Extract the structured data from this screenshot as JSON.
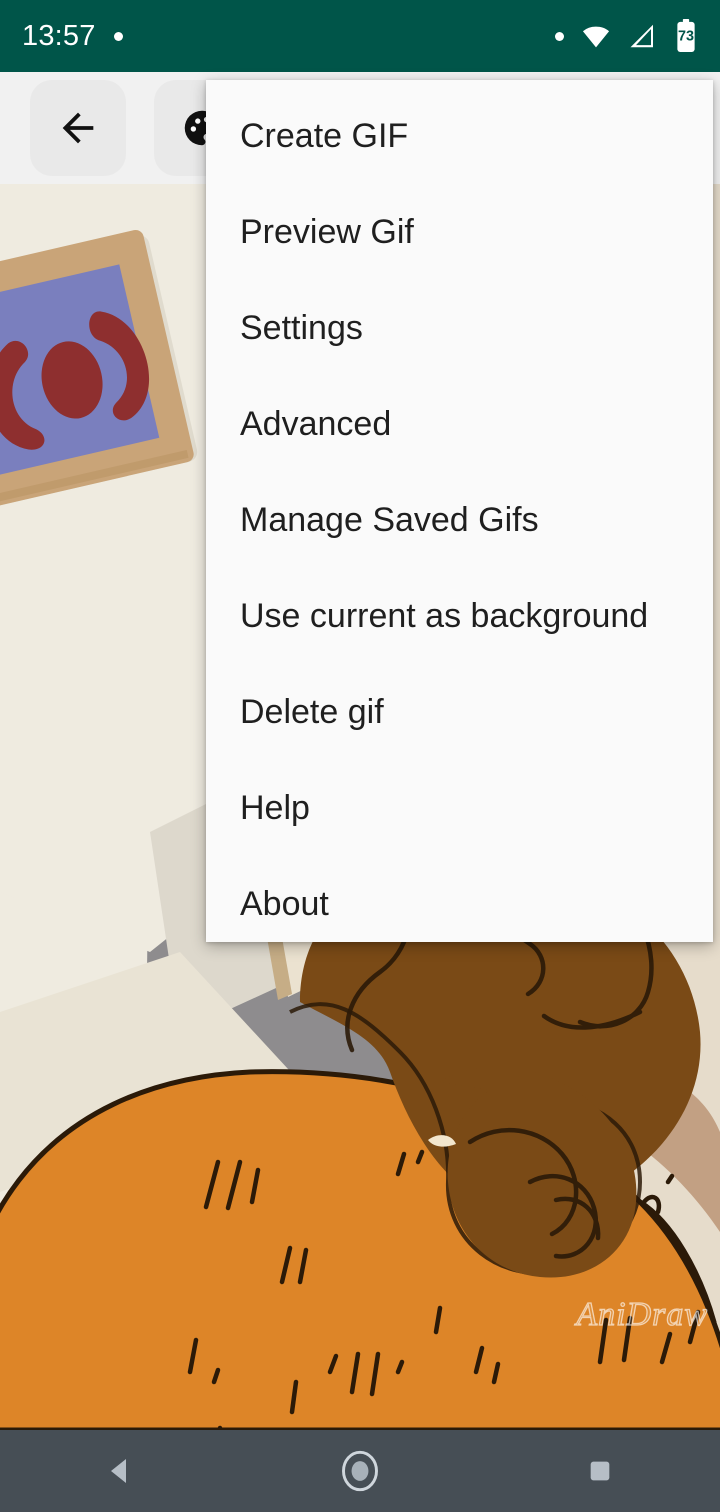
{
  "status_bar": {
    "time": "13:57",
    "notification_dot_icon": "dot-icon",
    "right_dot_icon": "dot-icon",
    "wifi_icon": "wifi-icon",
    "signal_icon": "cell-signal-icon",
    "battery_icon": "battery-icon",
    "battery_level": "73",
    "background_color": "#005549"
  },
  "toolbar": {
    "back_icon": "arrow-back-icon",
    "palette_icon": "color-palette-icon",
    "background_color": "#F1F1F1"
  },
  "menu": {
    "background_color": "#FAFAFA",
    "text_color": "#1F1F1F",
    "items": [
      {
        "label": "Create GIF",
        "name": "menu-item-create-gif"
      },
      {
        "label": "Preview Gif",
        "name": "menu-item-preview-gif"
      },
      {
        "label": "Settings",
        "name": "menu-item-settings"
      },
      {
        "label": "Advanced",
        "name": "menu-item-advanced"
      },
      {
        "label": "Manage Saved Gifs",
        "name": "menu-item-manage-saved-gifs"
      },
      {
        "label": "Use current as background",
        "name": "menu-item-use-current-as-background"
      },
      {
        "label": "Delete gif",
        "name": "menu-item-delete-gif"
      },
      {
        "label": "Help",
        "name": "menu-item-help"
      },
      {
        "label": "About",
        "name": "menu-item-about"
      }
    ]
  },
  "canvas": {
    "watermark": "AniDraw",
    "background_color": "#EFEBE0",
    "palette": {
      "wall_light": "#EFEBE0",
      "wall_shadow": "#E4E0D2",
      "door_gray": "#8E8C8E",
      "frame_tan": "#C9A478",
      "frame_inner_blue": "#7A7FBE",
      "paint_red": "#8E2F2F",
      "body_orange": "#DD8528",
      "hair_brown": "#7A4A16",
      "skin_tan": "#C2A083",
      "outline_dark": "#2B1A08"
    }
  },
  "nav_bar": {
    "background_color": "#464E55",
    "back_icon": "nav-back-triangle-icon",
    "home_icon": "nav-home-circle-icon",
    "recents_icon": "nav-recents-square-icon"
  }
}
